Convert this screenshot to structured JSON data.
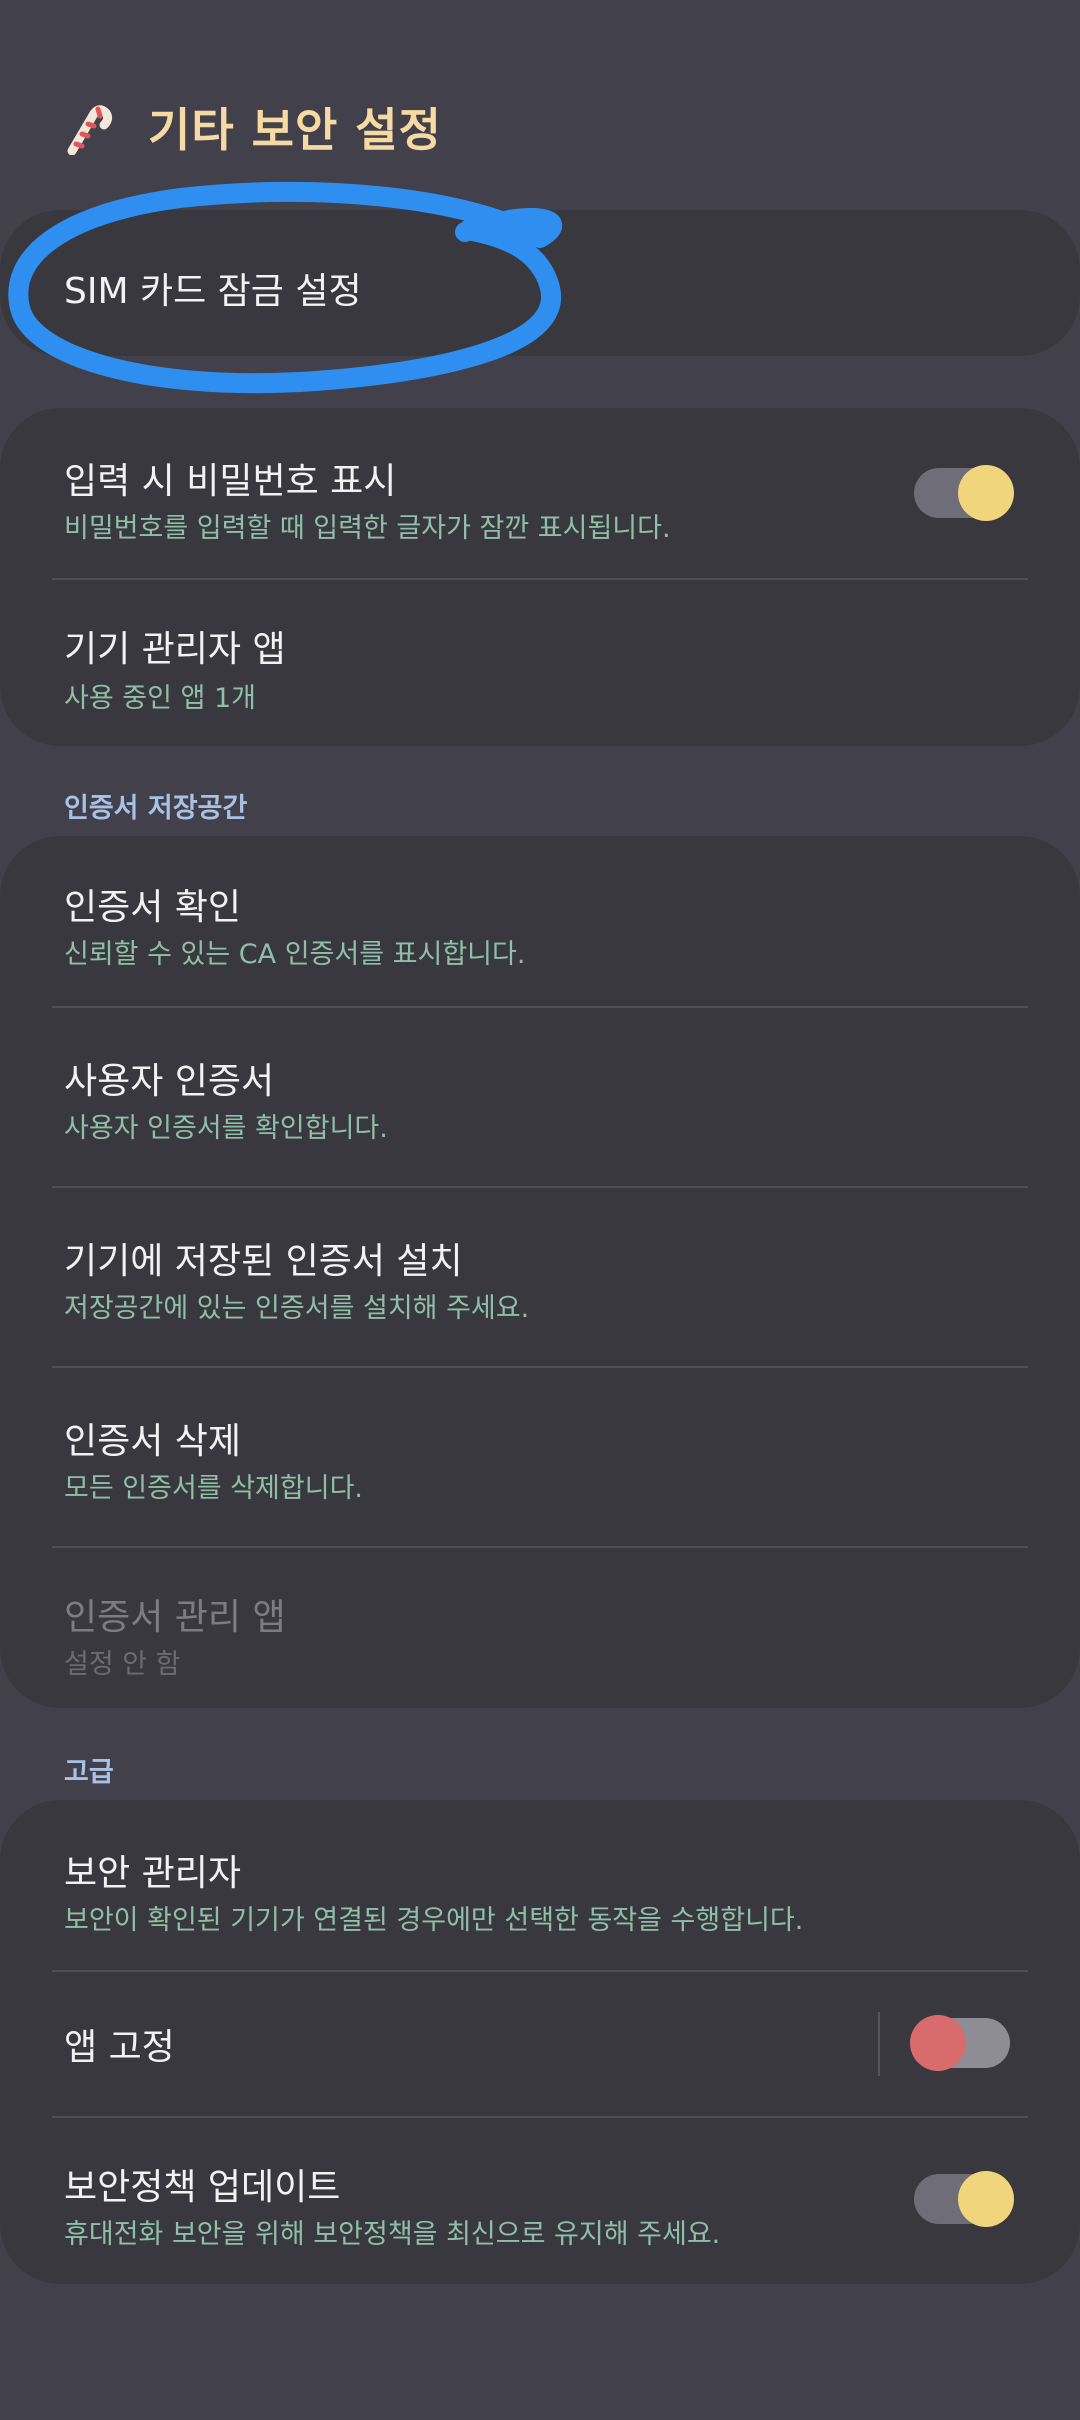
{
  "header": {
    "title": "기타 보안 설정",
    "icon": "candy-cane-icon"
  },
  "sim": {
    "title": "SIM 카드 잠금 설정"
  },
  "password": {
    "title": "입력 시 비밀번호 표시",
    "subtitle": "비밀번호를 입력할 때 입력한 글자가 잠깐 표시됩니다.",
    "toggle_on": true
  },
  "device_admin": {
    "title": "기기 관리자 앱",
    "subtitle": "사용 중인 앱 1개"
  },
  "cert_section": {
    "label": "인증서 저장공간",
    "items": [
      {
        "title": "인증서 확인",
        "subtitle": "신뢰할 수 있는 CA 인증서를 표시합니다."
      },
      {
        "title": "사용자 인증서",
        "subtitle": "사용자 인증서를 확인합니다."
      },
      {
        "title": "기기에 저장된 인증서 설치",
        "subtitle": "저장공간에 있는 인증서를 설치해 주세요."
      },
      {
        "title": "인증서 삭제",
        "subtitle": "모든 인증서를 삭제합니다."
      },
      {
        "title": "인증서 관리 앱",
        "subtitle": "설정 안 함",
        "disabled": true
      }
    ]
  },
  "advanced_section": {
    "label": "고급",
    "security_manager": {
      "title": "보안 관리자",
      "subtitle": "보안이 확인된 기기가 연결된 경우에만 선택한 동작을 수행합니다."
    },
    "app_pin": {
      "title": "앱 고정",
      "toggle_on": false
    },
    "policy_update": {
      "title": "보안정책 업데이트",
      "subtitle": "휴대전화 보안을 위해 보안정책을 최신으로 유지해 주세요.",
      "toggle_on": true
    }
  },
  "colors": {
    "background": "#42404b",
    "card": "#3a383f",
    "title_accent": "#f6d9a3",
    "subtitle_green": "#8fbfa7",
    "section_blue": "#a8c2e6",
    "toggle_knob_on": "#f1d57c",
    "toggle_knob_off": "#d86c6c",
    "annotation_blue": "#2f8ff0"
  }
}
